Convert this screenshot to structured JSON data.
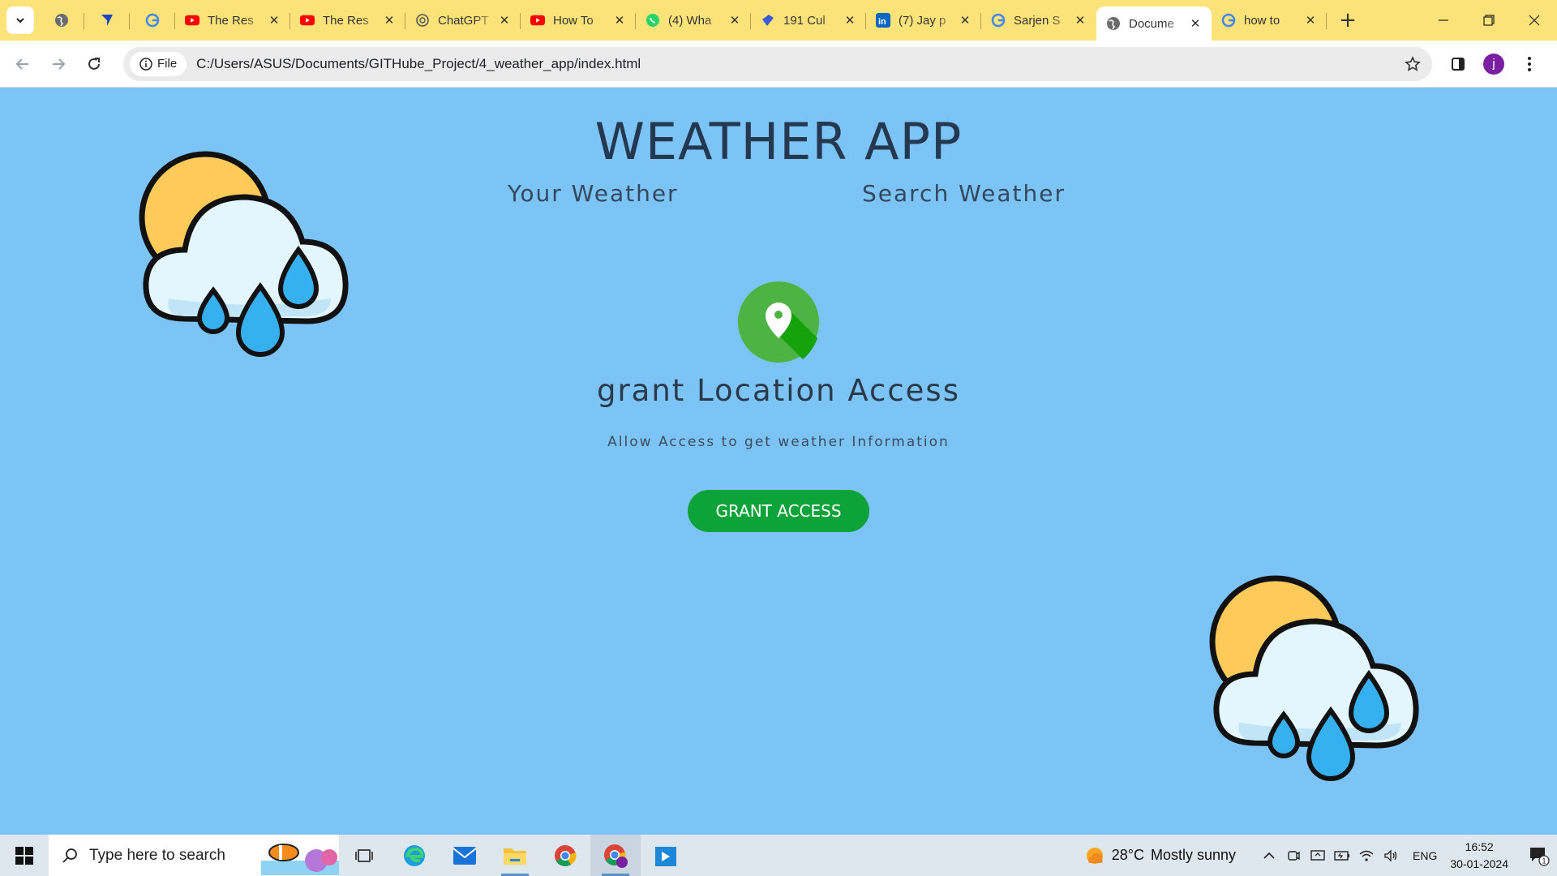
{
  "browser": {
    "tabs": [
      {
        "title": "",
        "icon": "globe-icon",
        "pinned": true
      },
      {
        "title": "",
        "icon": "arrow-logo-icon",
        "pinned": true
      },
      {
        "title": "",
        "icon": "google-icon",
        "pinned": true
      },
      {
        "title": "The Res",
        "icon": "youtube-icon"
      },
      {
        "title": "The Res",
        "icon": "youtube-icon"
      },
      {
        "title": "ChatGPT",
        "icon": "chatgpt-icon"
      },
      {
        "title": "How To",
        "icon": "youtube-icon"
      },
      {
        "title": "(4) Wha",
        "icon": "whatsapp-icon"
      },
      {
        "title": "191 Cul",
        "icon": "app-logo-icon"
      },
      {
        "title": "(7) Jay p",
        "icon": "linkedin-icon"
      },
      {
        "title": "Sarjen S",
        "icon": "google-icon"
      },
      {
        "title": "Docume",
        "icon": "globe-icon",
        "active": true
      },
      {
        "title": "how to",
        "icon": "google-icon"
      }
    ],
    "address": {
      "scheme_chip": "File",
      "url": "C:/Users/ASUS/Documents/GITHube_Project/4_weather_app/index.html"
    },
    "profile_initial": "j"
  },
  "page": {
    "title": "WEATHER APP",
    "tab_your_weather": "Your Weather",
    "tab_search_weather": "Search Weather",
    "grant_title": "grant Location Access",
    "grant_subtitle": "Allow Access to get weather Information",
    "grant_button": "GRANT ACCESS",
    "colors": {
      "background": "#7cc3f6",
      "button": "#0ea33a",
      "title": "#24384f"
    }
  },
  "taskbar": {
    "search_placeholder": "Type here to search",
    "weather_temp": "28°C",
    "weather_text": "Mostly sunny",
    "language": "ENG",
    "time": "16:52",
    "date": "30-01-2024",
    "notification_count": "1"
  }
}
